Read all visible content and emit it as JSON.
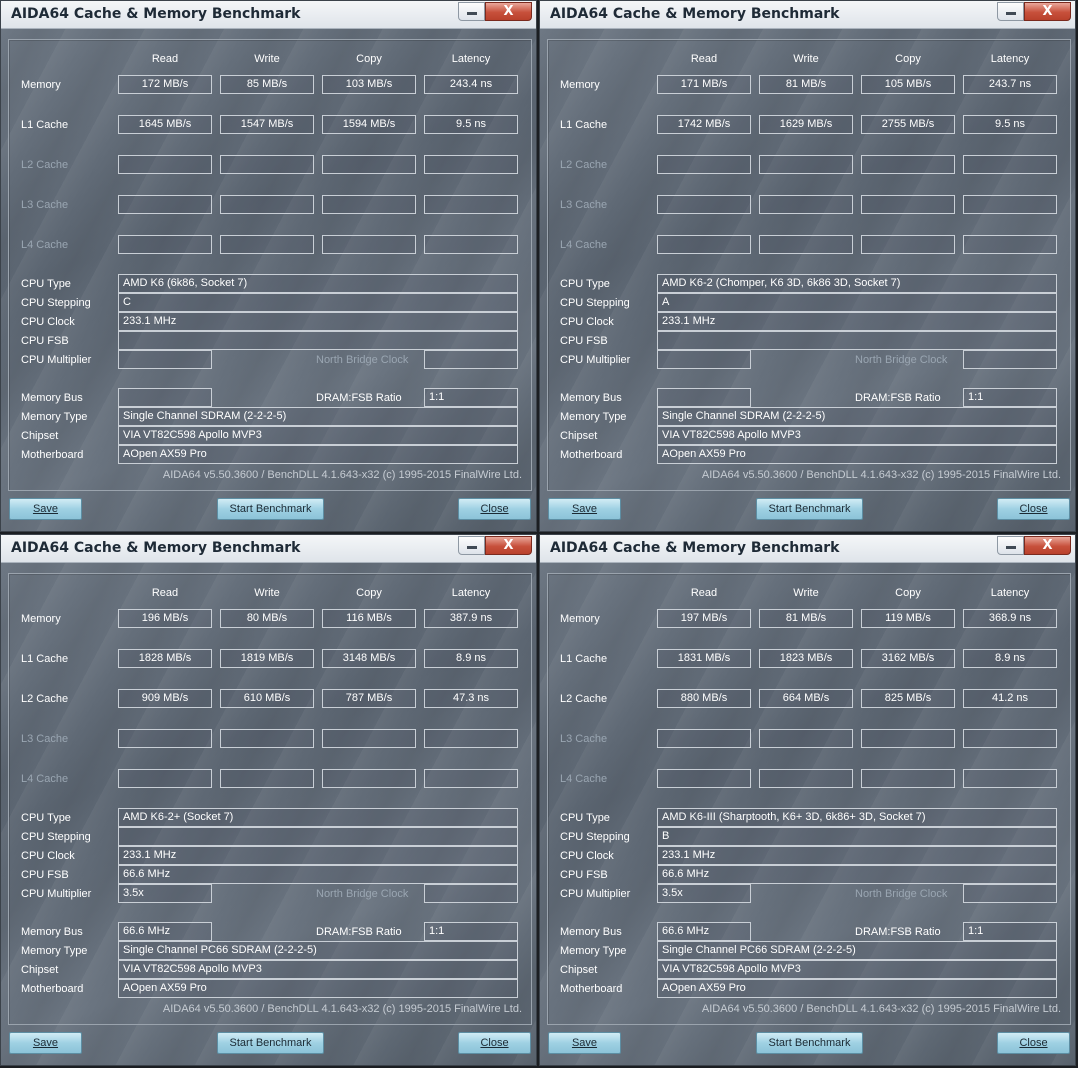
{
  "app_title": "AIDA64 Cache & Memory Benchmark",
  "columns": [
    "Read",
    "Write",
    "Copy",
    "Latency"
  ],
  "row_labels": {
    "memory": "Memory",
    "l1": "L1 Cache",
    "l2": "L2 Cache",
    "l3": "L3 Cache",
    "l4": "L4 Cache",
    "cpu_type": "CPU Type",
    "cpu_stepping": "CPU Stepping",
    "cpu_clock": "CPU Clock",
    "cpu_fsb": "CPU FSB",
    "cpu_multiplier": "CPU Multiplier",
    "north_bridge_clock": "North Bridge Clock",
    "memory_bus": "Memory Bus",
    "dram_fsb_ratio": "DRAM:FSB Ratio",
    "memory_type": "Memory Type",
    "chipset": "Chipset",
    "motherboard": "Motherboard"
  },
  "version_text": "AIDA64 v5.50.3600 / BenchDLL 4.1.643-x32  (c) 1995-2015 FinalWire Ltd.",
  "buttons": {
    "save": "Save",
    "start": "Start Benchmark",
    "close": "Close"
  },
  "window_controls": {
    "minimize_icon": "minimize-icon",
    "close_icon": "close-icon",
    "close_glyph": "X"
  },
  "colors": {
    "title_bar": "#e8ecf0",
    "panel_bg": "#626c78",
    "button_bg": "#a9d8e8",
    "close_button": "#c74a36"
  },
  "windows": [
    {
      "memory": [
        "172 MB/s",
        "85 MB/s",
        "103 MB/s",
        "243.4 ns"
      ],
      "l1": [
        "1645 MB/s",
        "1547 MB/s",
        "1594 MB/s",
        "9.5 ns"
      ],
      "l2": [
        "",
        "",
        "",
        ""
      ],
      "l2_active": false,
      "l3": [
        "",
        "",
        "",
        ""
      ],
      "l4": [
        "",
        "",
        "",
        ""
      ],
      "cpu_type": "AMD K6  (6k86, Socket 7)",
      "cpu_stepping": "C",
      "cpu_clock": "233.1 MHz",
      "cpu_fsb": "",
      "cpu_multiplier": "",
      "north_bridge_clock": "",
      "memory_bus": "",
      "dram_fsb_ratio": "1:1",
      "memory_type": "Single Channel  SDRAM  (2-2-2-5)",
      "chipset": "VIA VT82C598 Apollo MVP3",
      "motherboard": "AOpen AX59 Pro"
    },
    {
      "memory": [
        "171 MB/s",
        "81 MB/s",
        "105 MB/s",
        "243.7 ns"
      ],
      "l1": [
        "1742 MB/s",
        "1629 MB/s",
        "2755 MB/s",
        "9.5 ns"
      ],
      "l2": [
        "",
        "",
        "",
        ""
      ],
      "l2_active": false,
      "l3": [
        "",
        "",
        "",
        ""
      ],
      "l4": [
        "",
        "",
        "",
        ""
      ],
      "cpu_type": "AMD K6-2  (Chomper, K6 3D, 6k86 3D, Socket 7)",
      "cpu_stepping": "A",
      "cpu_clock": "233.1 MHz",
      "cpu_fsb": "",
      "cpu_multiplier": "",
      "north_bridge_clock": "",
      "memory_bus": "",
      "dram_fsb_ratio": "1:1",
      "memory_type": "Single Channel  SDRAM  (2-2-2-5)",
      "chipset": "VIA VT82C598 Apollo MVP3",
      "motherboard": "AOpen AX59 Pro"
    },
    {
      "memory": [
        "196 MB/s",
        "80 MB/s",
        "116 MB/s",
        "387.9 ns"
      ],
      "l1": [
        "1828 MB/s",
        "1819 MB/s",
        "3148 MB/s",
        "8.9 ns"
      ],
      "l2": [
        "909 MB/s",
        "610 MB/s",
        "787 MB/s",
        "47.3 ns"
      ],
      "l2_active": true,
      "l3": [
        "",
        "",
        "",
        ""
      ],
      "l4": [
        "",
        "",
        "",
        ""
      ],
      "cpu_type": "AMD K6-2+  (Socket 7)",
      "cpu_stepping": "",
      "cpu_clock": "233.1 MHz",
      "cpu_fsb": "66.6 MHz",
      "cpu_multiplier": "3.5x",
      "north_bridge_clock": "",
      "memory_bus": "66.6 MHz",
      "dram_fsb_ratio": "1:1",
      "memory_type": "Single Channel PC66 SDRAM  (2-2-2-5)",
      "chipset": "VIA VT82C598 Apollo MVP3",
      "motherboard": "AOpen AX59 Pro"
    },
    {
      "memory": [
        "197 MB/s",
        "81 MB/s",
        "119 MB/s",
        "368.9 ns"
      ],
      "l1": [
        "1831 MB/s",
        "1823 MB/s",
        "3162 MB/s",
        "8.9 ns"
      ],
      "l2": [
        "880 MB/s",
        "664 MB/s",
        "825 MB/s",
        "41.2 ns"
      ],
      "l2_active": true,
      "l3": [
        "",
        "",
        "",
        ""
      ],
      "l4": [
        "",
        "",
        "",
        ""
      ],
      "cpu_type": "AMD K6-III  (Sharptooth, K6+ 3D, 6k86+ 3D, Socket 7)",
      "cpu_stepping": "B",
      "cpu_clock": "233.1 MHz",
      "cpu_fsb": "66.6 MHz",
      "cpu_multiplier": "3.5x",
      "north_bridge_clock": "",
      "memory_bus": "66.6 MHz",
      "dram_fsb_ratio": "1:1",
      "memory_type": "Single Channel PC66 SDRAM  (2-2-2-5)",
      "chipset": "VIA VT82C598 Apollo MVP3",
      "motherboard": "AOpen AX59 Pro"
    }
  ]
}
